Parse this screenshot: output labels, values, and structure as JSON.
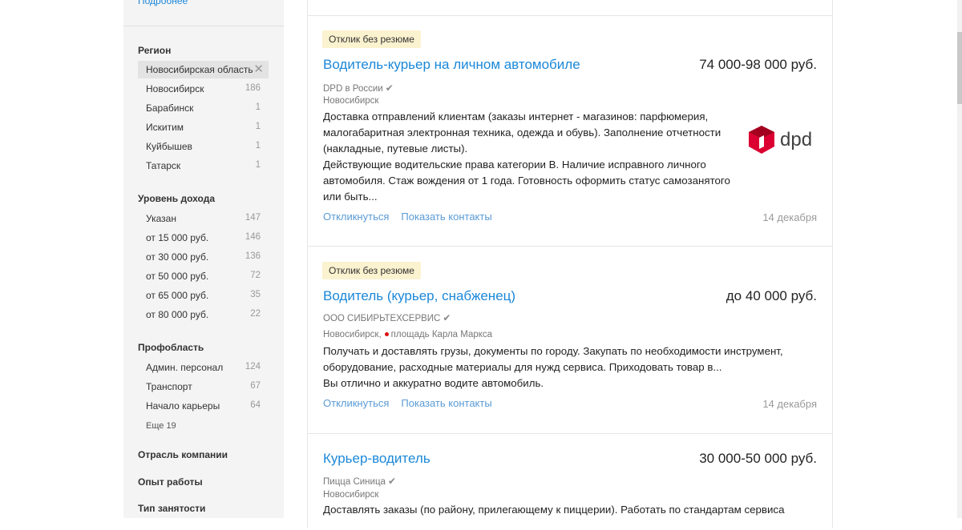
{
  "sidebar": {
    "top_link": "Подробнее",
    "region": {
      "heading": "Регион",
      "selected": "Новосибирская область",
      "items": [
        {
          "label": "Новосибирск",
          "count": "186"
        },
        {
          "label": "Барабинск",
          "count": "1"
        },
        {
          "label": "Искитим",
          "count": "1"
        },
        {
          "label": "Куйбышев",
          "count": "1"
        },
        {
          "label": "Татарск",
          "count": "1"
        }
      ]
    },
    "income": {
      "heading": "Уровень дохода",
      "items": [
        {
          "label": "Указан",
          "count": "147"
        },
        {
          "label": "от 15 000 руб.",
          "count": "146"
        },
        {
          "label": "от 30 000 руб.",
          "count": "136"
        },
        {
          "label": "от 50 000 руб.",
          "count": "72"
        },
        {
          "label": "от 65 000 руб.",
          "count": "35"
        },
        {
          "label": "от 80 000 руб.",
          "count": "22"
        }
      ]
    },
    "prof": {
      "heading": "Профобласть",
      "items": [
        {
          "label": "Админ. персонал",
          "count": "124"
        },
        {
          "label": "Транспорт",
          "count": "67"
        },
        {
          "label": "Начало карьеры",
          "count": "64"
        }
      ],
      "more": "Еще 19"
    },
    "industry_heading": "Отрасль компании",
    "experience_heading": "Опыт работы",
    "employment_heading": "Тип занятости"
  },
  "vacancies": [
    {
      "badge": "Отклик без резюме",
      "title": "Водитель-курьер на личном автомобиле",
      "salary": "74 000-98 000 руб.",
      "company": "DPD в России",
      "city": "Новосибирск",
      "desc1": "Доставка отправлений клиентам (заказы интернет - магазинов: парфюмерия, малогабаритная электронная техника, одежда и обувь). Заполнение отчетности (накладные, путевые листы).",
      "desc2": "Действующие водительские права категории В. Наличие исправного личного автомобиля. Стаж вождения от 1 года. Готовность оформить статус самозанятого или быть...",
      "respond": "Откликнуться",
      "contacts": "Показать контакты",
      "date": "14 декабря",
      "logo_text": "dpd"
    },
    {
      "badge": "Отклик без резюме",
      "title": "Водитель (курьер, снабженец)",
      "salary": "до 40 000 руб.",
      "company": "ООО СИБИРЬТЕХСЕРВИС",
      "city": "Новосибирск,",
      "metro": "площадь Карла Маркса",
      "desc1": "Получать и доставлять грузы, документы по городу. Закупать по необходимости инструмент, оборудование, расходные материалы для нужд сервиса. Приходовать товар в...",
      "desc2": "Вы отлично и аккуратно водите автомобиль.",
      "respond": "Откликнуться",
      "contacts": "Показать контакты",
      "date": "14 декабря"
    },
    {
      "title": "Курьер-водитель",
      "salary": "30 000-50 000 руб.",
      "company": "Пицца Синица",
      "city": "Новосибирск",
      "desc1": "Доставлять заказы (по району, прилегающему к пиццерии). Работать по стандартам сервиса"
    }
  ]
}
